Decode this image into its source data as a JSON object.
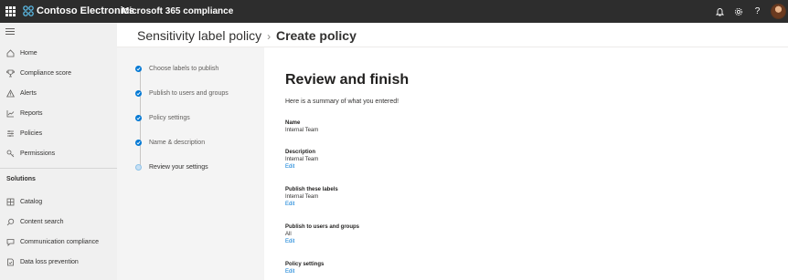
{
  "topbar": {
    "brand": "Contoso Electronics",
    "app_name": "Microsoft 365 compliance"
  },
  "leftnav": {
    "items": [
      {
        "label": "Home",
        "icon": "home-icon"
      },
      {
        "label": "Compliance score",
        "icon": "trophy-icon"
      },
      {
        "label": "Alerts",
        "icon": "warning-icon"
      },
      {
        "label": "Reports",
        "icon": "chart-icon"
      },
      {
        "label": "Policies",
        "icon": "sliders-icon"
      },
      {
        "label": "Permissions",
        "icon": "key-icon"
      }
    ],
    "section_title": "Solutions",
    "solution_items": [
      {
        "label": "Catalog",
        "icon": "grid-icon"
      },
      {
        "label": "Content search",
        "icon": "search-icon"
      },
      {
        "label": "Communication compliance",
        "icon": "chat-icon"
      },
      {
        "label": "Data loss prevention",
        "icon": "shield-doc-icon"
      }
    ]
  },
  "header": {
    "parent": "Sensitivity label policy",
    "separator": "›",
    "current": "Create policy"
  },
  "wizard": {
    "steps": [
      {
        "label": "Choose labels to publish",
        "status": "complete"
      },
      {
        "label": "Publish to users and groups",
        "status": "complete"
      },
      {
        "label": "Policy settings",
        "status": "complete"
      },
      {
        "label": "Name & description",
        "status": "complete"
      },
      {
        "label": "Review your settings",
        "status": "current"
      }
    ]
  },
  "review": {
    "title": "Review and finish",
    "summary": "Here is a summary of what you entered!",
    "name_label": "Name",
    "name_value": "Internal Team",
    "description_label": "Description",
    "description_value": "Internal Team",
    "labels_label": "Publish these labels",
    "labels_value": "Internal Team",
    "users_label": "Publish to users and groups",
    "users_value": "All",
    "policy_label": "Policy settings",
    "edit": "Edit"
  },
  "colors": {
    "topbar": "#2d2d2d",
    "accent": "#0078d4",
    "nav_bg": "#f0f0f0"
  }
}
